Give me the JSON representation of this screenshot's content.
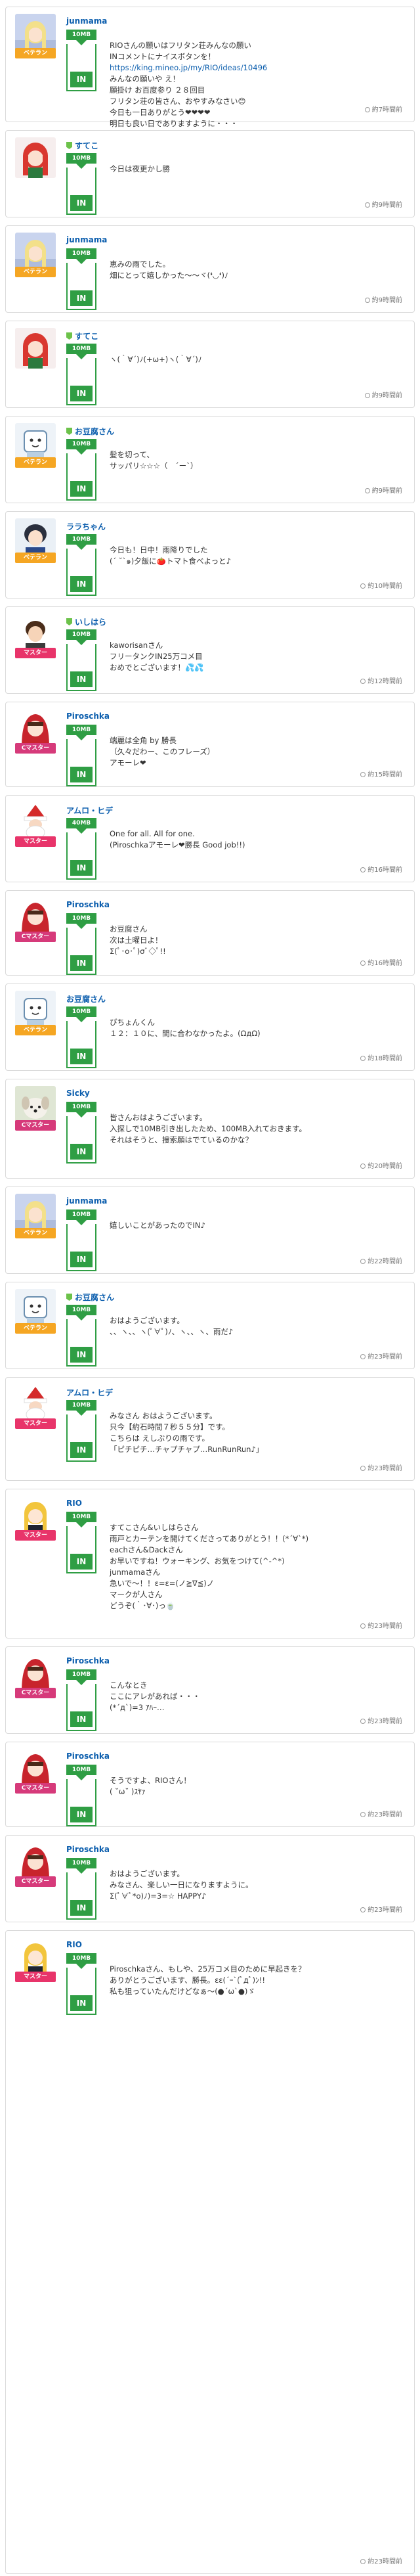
{
  "posts": [
    {
      "user": "junmama",
      "badge": "ベテラン",
      "badge_type": "veteran",
      "plan": "10MB",
      "action": "IN",
      "time": "約7時間前",
      "avatar": "blonde-girl-icon",
      "mark": false,
      "message": "RIOさんの願いはフリタン荘みんなの願い\nINコメントにナイスボタンを！\n",
      "link": "https://king.mineo.jp/my/RIO/ideas/10496",
      "message2": "\nみんなの願いや え！\n願掛け お百度参り ２８回目\nフリタン荘の皆さん、おやすみなさい😊\n今日も一日ありがとう❤❤❤❤\n明日も良い日でありますように・・・"
    },
    {
      "user": "すてこ",
      "badge": "",
      "badge_type": "",
      "plan": "10MB",
      "action": "IN",
      "time": "約9時間前",
      "avatar": "red-hair-girl-icon",
      "mark": true,
      "message": "今日は夜更かし勝"
    },
    {
      "user": "junmama",
      "badge": "ベテラン",
      "badge_type": "veteran",
      "plan": "10MB",
      "action": "IN",
      "time": "約9時間前",
      "avatar": "blonde-girl-icon",
      "mark": false,
      "message": "恵みの雨でした。\n畑にとって嬉しかった〜〜ヾ(❛◡❛)ﾉ"
    },
    {
      "user": "すてこ",
      "badge": "",
      "badge_type": "",
      "plan": "10MB",
      "action": "IN",
      "time": "約9時間前",
      "avatar": "red-hair-girl-icon",
      "mark": true,
      "message": "ヽ(｀∀´)ﾉ(+ω+)ヽ(｀∀´)ﾉ"
    },
    {
      "user": "お豆腐さん",
      "badge": "ベテラン",
      "badge_type": "veteran",
      "plan": "10MB",
      "action": "IN",
      "time": "約9時間前",
      "avatar": "tofu-ghost-icon",
      "mark": true,
      "message": "髪を切って、\nサッパリ☆☆☆（　´ー`）"
    },
    {
      "user": "ララちゃん",
      "badge": "ベテラン",
      "badge_type": "veteran",
      "plan": "10MB",
      "action": "IN",
      "time": "約10時間前",
      "avatar": "dark-hair-boy-icon",
      "mark": false,
      "message": "今日も！日中！雨降りでした\n(´ ˘`๑)夕飯に🍅トマト食べよっと♪"
    },
    {
      "user": "いしはら",
      "badge": "マスター",
      "badge_type": "master",
      "plan": "10MB",
      "action": "IN",
      "time": "約12時間前",
      "avatar": "brown-hair-boy-icon",
      "mark": true,
      "message": "kaworisanさん\nフリータンクIN25万コメ目\nおめでとございます！💦💦"
    },
    {
      "user": "Piroschka",
      "badge": "Cマスター",
      "badge_type": "cmaster",
      "plan": "10MB",
      "action": "IN",
      "time": "約15時間前",
      "avatar": "red-hood-icon",
      "mark": false,
      "message": "端麗は全角 by 勝長\n（久々だわー、このフレーズ）\nアモーレ❤"
    },
    {
      "user": "アムロ・ヒデ",
      "badge": "マスター",
      "badge_type": "master",
      "plan": "40MB",
      "action": "IN",
      "time": "約16時間前",
      "avatar": "santa-icon",
      "mark": false,
      "message": "One for all. All for one.\n(Piroschkaアモーレ❤勝長 Good job!!)"
    },
    {
      "user": "Piroschka",
      "badge": "Cマスター",
      "badge_type": "cmaster",
      "plan": "10MB",
      "action": "IN",
      "time": "約16時間前",
      "avatar": "red-hood-icon",
      "mark": false,
      "message": "お豆腐さん\n次は土曜日よ！\nΣ(ﾟ･o･ﾟ)σﾞ◇ﾟ!!"
    },
    {
      "user": "お豆腐さん",
      "badge": "ベテラン",
      "badge_type": "veteran",
      "plan": "10MB",
      "action": "IN",
      "time": "約18時間前",
      "avatar": "tofu-ghost-icon",
      "mark": false,
      "message": "ぴちょんくん\n１２：１０に、間に合わなかったよ。(ΩдΩ)"
    },
    {
      "user": "Sicky",
      "badge": "Cマスター",
      "badge_type": "cmaster",
      "plan": "10MB",
      "action": "IN",
      "time": "約20時間前",
      "avatar": "dog-icon",
      "mark": false,
      "message": "皆さんおはようございます。\n入探しで10MB引き出したため、100MB入れておきます。\nそれはそうと、捜索願はでているのかな？"
    },
    {
      "user": "junmama",
      "badge": "ベテラン",
      "badge_type": "veteran",
      "plan": "10MB",
      "action": "IN",
      "time": "約22時間前",
      "avatar": "blonde-girl-icon",
      "mark": false,
      "message": "嬉しいことがあったのでIN♪"
    },
    {
      "user": "お豆腐さん",
      "badge": "ベテラン",
      "badge_type": "veteran",
      "plan": "10MB",
      "action": "IN",
      "time": "約23時間前",
      "avatar": "tofu-ghost-icon",
      "mark": true,
      "message": "おはようございます。\n、、ヽ、、ヽ(ﾟ∀ﾟ)ﾉ、ヽ、、ヽ、雨だ♪"
    },
    {
      "user": "アムロ・ヒデ",
      "badge": "マスター",
      "badge_type": "master",
      "plan": "10MB",
      "action": "IN",
      "time": "約23時間前",
      "avatar": "santa-icon",
      "mark": false,
      "message": "みなさん おはようございます。\n只今【約石時間７秒５５分】です。\nこちらは えしぶりの雨です。\n「ピチピチ…チャプチャプ…RunRunRun♪」"
    },
    {
      "user": "RIO",
      "badge": "マスター",
      "badge_type": "master",
      "plan": "10MB",
      "action": "IN",
      "time": "約23時間前",
      "avatar": "yellow-hair-girl-icon",
      "mark": false,
      "message": "すてこさん&いしはらさん\n雨戸とカーテンを開けてくださってありがとう！！(*´∀`*)\neachさん&Dackさん\nお早いですね！ウォーキング、お気をつけて(^-^*)\njunmamaさん\n急いで〜！！ε=ε=(ノ≧∇≦)ノ\nマークが人さん\nどうぞ(｀･∀･)っ🍵"
    },
    {
      "user": "Piroschka",
      "badge": "Cマスター",
      "badge_type": "cmaster",
      "plan": "10MB",
      "action": "IN",
      "time": "約23時間前",
      "avatar": "red-hood-icon",
      "mark": false,
      "message": "こんなとき\nここにアレがあれば・・・\n(*´д`)=3 ｱﾊｰ…"
    },
    {
      "user": "Piroschka",
      "badge": "Cマスター",
      "badge_type": "cmaster",
      "plan": "10MB",
      "action": "IN",
      "time": "約23時間前",
      "avatar": "red-hood-icon",
      "mark": false,
      "message": "そうですよ、RIOさん！\n( ˘ω˘ )ｽﾔｧ"
    },
    {
      "user": "Piroschka",
      "badge": "Cマスター",
      "badge_type": "cmaster",
      "plan": "10MB",
      "action": "IN",
      "time": "約23時間前",
      "avatar": "red-hood-icon",
      "mark": false,
      "message": "おはようございます。\nみなさん、楽しい一日になりますように。\nΣ(ﾟ∀ﾟ*o)ﾉ)=3=☆ HAPPY♪"
    },
    {
      "user": "RIO",
      "badge": "マスター",
      "badge_type": "master",
      "plan": "10MB",
      "action": "IN",
      "time": "約23時間前",
      "avatar": "yellow-hair-girl-icon",
      "mark": false,
      "message": "Piroschkaさん、もしや、25万コメ目のために早起きを？\nありがとうございます、勝長。εε(´ｰ`(ﾟдﾟ)ﾝ!!\n私も狙っていたんだけどなぁ〜(●´ω`●)ゞ"
    }
  ],
  "colors": {
    "accent": "#2f9e44",
    "link": "#0d5fae",
    "veteran": "#f5a623",
    "master": "#e8346a",
    "cmaster": "#d63a7a"
  }
}
